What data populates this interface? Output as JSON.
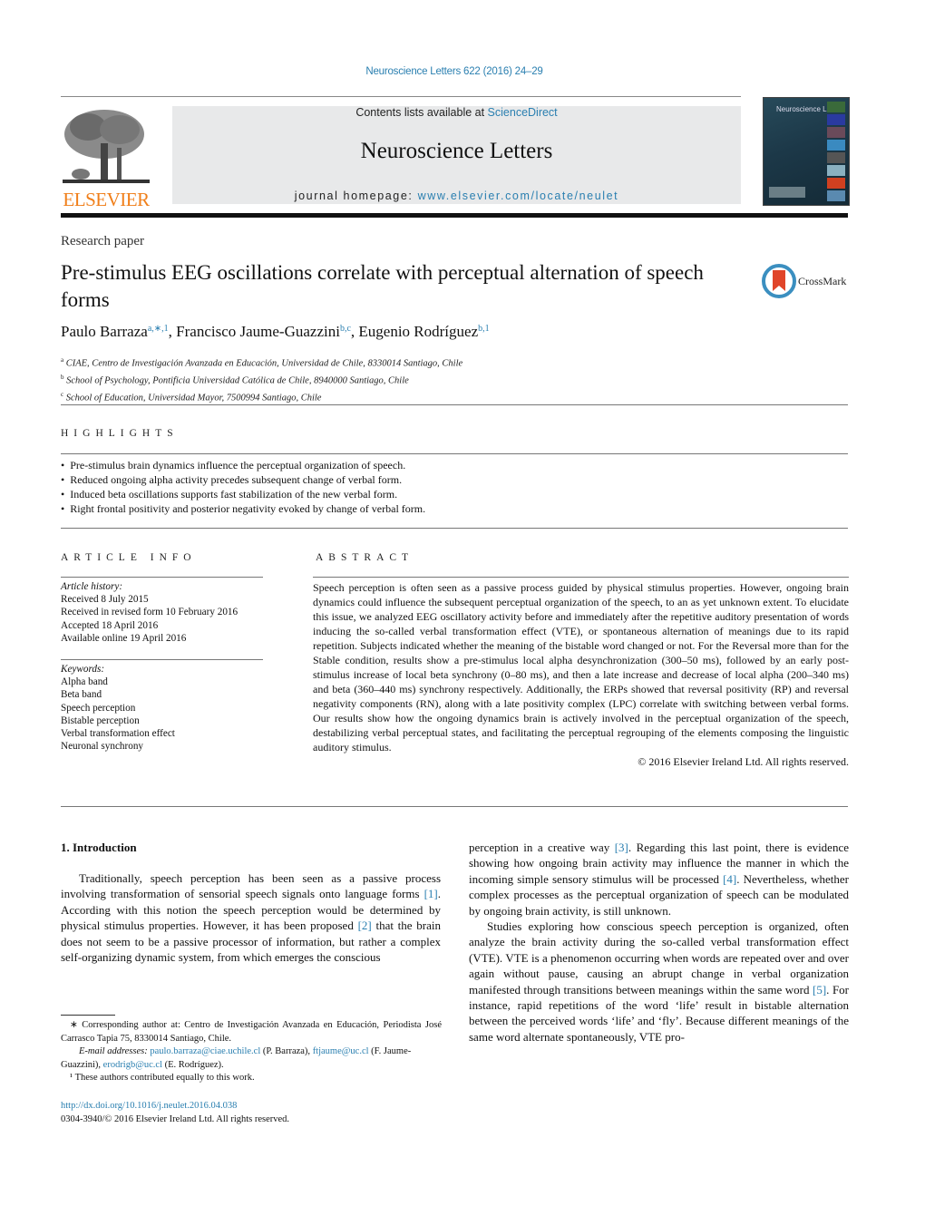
{
  "header": {
    "journal_ref": "Neuroscience Letters 622 (2016) 24–29",
    "contents_prefix": "Contents lists available at ",
    "contents_link": "ScienceDirect",
    "journal_title": "Neuroscience Letters",
    "homepage_prefix": "journal homepage: ",
    "homepage_link": "www.elsevier.com/locate/neulet",
    "publisher_logo_text": "ELSEVIER",
    "cover_title": "Neuroscience Letters",
    "crossmark_label": "CrossMark"
  },
  "article": {
    "type": "Research paper",
    "title": "Pre-stimulus EEG oscillations correlate with perceptual alternation of speech forms",
    "authors": [
      {
        "name": "Paulo Barraza",
        "sup": "a,∗,1",
        "sep": ", "
      },
      {
        "name": "Francisco Jaume-Guazzini",
        "sup": "b,c",
        "sep": ", "
      },
      {
        "name": "Eugenio Rodríguez",
        "sup": "b,1",
        "sep": ""
      }
    ],
    "affiliations": [
      {
        "key": "a",
        "text": "CIAE, Centro de Investigación Avanzada en Educación, Universidad de Chile, 8330014 Santiago, Chile"
      },
      {
        "key": "b",
        "text": "School of Psychology, Pontificia Universidad Católica de Chile, 8940000 Santiago, Chile"
      },
      {
        "key": "c",
        "text": "School of Education, Universidad Mayor, 7500994 Santiago, Chile"
      }
    ]
  },
  "highlights": {
    "heading": "HIGHLIGHTS",
    "items": [
      "Pre-stimulus brain dynamics influence the perceptual organization of speech.",
      "Reduced ongoing alpha activity precedes subsequent change of verbal form.",
      "Induced beta oscillations supports fast stabilization of the new verbal form.",
      "Right frontal positivity and posterior negativity evoked by change of verbal form."
    ]
  },
  "article_info": {
    "heading": "ARTICLE INFO",
    "history_label": "Article history:",
    "history": [
      "Received 8 July 2015",
      "Received in revised form 10 February 2016",
      "Accepted 18 April 2016",
      "Available online 19 April 2016"
    ],
    "keywords_label": "Keywords:",
    "keywords": [
      "Alpha band",
      "Beta band",
      "Speech perception",
      "Bistable perception",
      "Verbal transformation effect",
      "Neuronal synchrony"
    ]
  },
  "abstract": {
    "heading": "ABSTRACT",
    "text": "Speech perception is often seen as a passive process guided by physical stimulus properties. However, ongoing brain dynamics could influence the subsequent perceptual organization of the speech, to an as yet unknown extent. To elucidate this issue, we analyzed EEG oscillatory activity before and immediately after the repetitive auditory presentation of words inducing the so-called verbal transformation effect (VTE), or spontaneous alternation of meanings due to its rapid repetition. Subjects indicated whether the meaning of the bistable word changed or not. For the Reversal more than for the Stable condition, results show a pre-stimulus local alpha desynchronization (300–50 ms), followed by an early post-stimulus increase of local beta synchrony (0–80 ms), and then a late increase and decrease of local alpha (200–340 ms) and beta (360–440 ms) synchrony respectively. Additionally, the ERPs showed that reversal positivity (RP) and reversal negativity components (RN), along with a late positivity complex (LPC) correlate with switching between verbal forms. Our results show how the ongoing dynamics brain is actively involved in the perceptual organization of the speech, destabilizing verbal perceptual states, and facilitating the perceptual regrouping of the elements composing the linguistic auditory stimulus.",
    "copyright": "© 2016 Elsevier Ireland Ltd. All rights reserved."
  },
  "introduction": {
    "heading": "1.  Introduction",
    "left_col": {
      "p1_a": "Traditionally, speech perception has been seen as a passive process involving transformation of sensorial speech signals onto language forms ",
      "ref1": "[1]",
      "p1_b": ". According with this notion the speech perception would be determined by physical stimulus properties. However, it has been proposed ",
      "ref2": "[2]",
      "p1_c": " that the brain does not seem to be a passive processor of information, but rather a complex self-organizing dynamic system, from which emerges the conscious"
    },
    "right_col": {
      "p1_a": "perception in a creative way ",
      "ref3": "[3]",
      "p1_b": ". Regarding this last point, there is evidence showing how ongoing brain activity may influence the manner in which the incoming simple sensory stimulus will be processed ",
      "ref4": "[4]",
      "p1_c": ". Nevertheless, whether complex processes as the perceptual organization of speech can be modulated by ongoing brain activity, is still unknown.",
      "p2_a": "Studies exploring how conscious speech perception is organized, often analyze the brain activity during the so-called verbal transformation effect (VTE). VTE is a phenomenon occurring when words are repeated over and over again without pause, causing an abrupt change in verbal organization manifested through transitions between meanings within the same word ",
      "ref5": "[5]",
      "p2_b": ". For instance, rapid repetitions of the word ‘life’ result in bistable alternation between the perceived words ‘life’ and ‘fly’. Because different meanings of the same word alternate spontaneously, VTE pro-"
    }
  },
  "footnotes": {
    "corresponding": "∗ Corresponding author at: Centro de Investigación Avanzada en Educación, Periodista José Carrasco Tapia 75, 8330014 Santiago, Chile.",
    "email_label": "E-mail addresses: ",
    "emails": [
      {
        "address": "paulo.barraza@ciae.uchile.cl",
        "who": " (P. Barraza), "
      },
      {
        "address": "ftjaume@uc.cl",
        "who": " (F. Jaume-Guazzini), "
      },
      {
        "address": "erodrigb@uc.cl",
        "who": " (E. Rodríguez)."
      }
    ],
    "equal": "¹ These authors contributed equally to this work."
  },
  "doi": {
    "link": "http://dx.doi.org/10.1016/j.neulet.2016.04.038",
    "issn": "0304-3940/© 2016 Elsevier Ireland Ltd. All rights reserved."
  },
  "colors": {
    "link": "#2a7fb0",
    "elsevier_orange": "#f07f1a",
    "banner_bg": "#e8e9ea"
  }
}
